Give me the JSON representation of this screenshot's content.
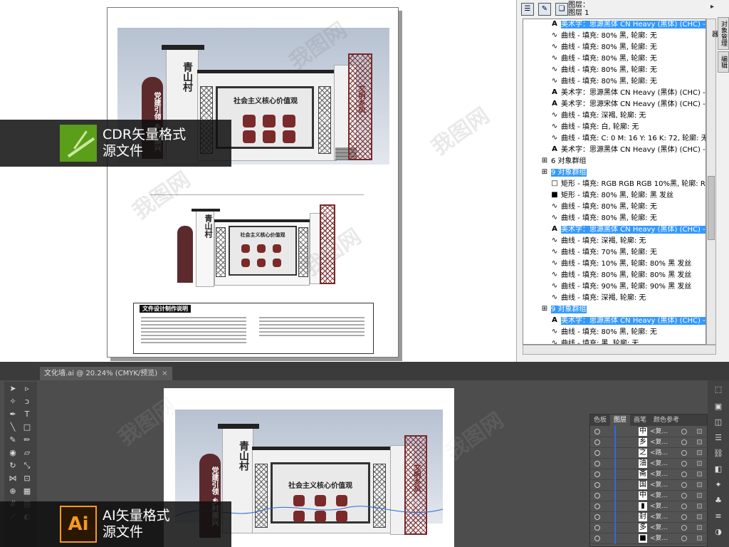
{
  "cdr": {
    "layer_header": [
      "图层：",
      "图层 1"
    ],
    "tree_rows": [
      {
        "icon": "A",
        "text": "美术字：思源黑体 CN Heavy (黑体) (CHC) - ",
        "selected": true,
        "indent": 38
      },
      {
        "icon": "curve",
        "text": "曲线 - 填充: 80% 黑, 轮廓: 无",
        "selected": false,
        "indent": 38
      },
      {
        "icon": "curve",
        "text": "曲线 - 填充: 80% 黑, 轮廓: 无",
        "selected": false,
        "indent": 38
      },
      {
        "icon": "curve",
        "text": "曲线 - 填充: 80% 黑, 轮廓: 无",
        "selected": false,
        "indent": 38
      },
      {
        "icon": "curve",
        "text": "曲线 - 填充: 80% 黑, 轮廓: 无",
        "selected": false,
        "indent": 38
      },
      {
        "icon": "curve",
        "text": "曲线 - 填充: 80% 黑, 轮廓: 无",
        "selected": false,
        "indent": 38
      },
      {
        "icon": "A",
        "text": "美术字：思源黑体 CN Heavy (黑体) (CHC) - 填充: 8",
        "selected": false,
        "indent": 38
      },
      {
        "icon": "A",
        "text": "美术字：思源宋体 CN Heavy (黑体) (CHC) - ",
        "selected": false,
        "indent": 38
      },
      {
        "icon": "curve",
        "text": "曲线 - 填充: 深褐, 轮廓: 无",
        "selected": false,
        "indent": 38
      },
      {
        "icon": "curve",
        "text": "曲线 - 填充: 白, 轮廓: 无",
        "selected": false,
        "indent": 38
      },
      {
        "icon": "curve",
        "text": "曲线 - 填充: C: 0 M: 16 Y: 16 K: 72, 轮廓: 无",
        "selected": false,
        "indent": 38
      },
      {
        "icon": "A",
        "text": "美术字：思源黑体 CN Heavy (黑体) (CHC) - ",
        "selected": false,
        "indent": 38
      },
      {
        "icon": "group",
        "text": "6 对象群组",
        "selected": false,
        "indent": 24
      },
      {
        "icon": "group",
        "text": "9 对象群组",
        "selected": true,
        "indent": 24
      },
      {
        "icon": "rect-empty",
        "text": "矩形 - 填充: RGB RGB RGB 10%黑, 轮廓: RG",
        "selected": false,
        "indent": 38
      },
      {
        "icon": "rect-fill",
        "text": "矩形 - 填充: 80% 黑, 轮廓: 黑 发丝",
        "selected": false,
        "indent": 38
      },
      {
        "icon": "curve",
        "text": "曲线 - 填充: 80% 黑, 轮廓: 无",
        "selected": false,
        "indent": 38
      },
      {
        "icon": "curve",
        "text": "曲线 - 填充: 80% 黑, 轮廓: 无",
        "selected": false,
        "indent": 38
      },
      {
        "icon": "A",
        "text": "美术字：思源黑体 CN Heavy (黑体) (CHC) - ",
        "selected": true,
        "indent": 38
      },
      {
        "icon": "curve",
        "text": "曲线 - 填充: 深褐, 轮廓: 无",
        "selected": false,
        "indent": 38
      },
      {
        "icon": "curve",
        "text": "曲线 - 填充: 70% 黑, 轮廓: 无",
        "selected": false,
        "indent": 38
      },
      {
        "icon": "curve",
        "text": "曲线 - 填充: 10% 黑, 轮廓: 80% 黑 发丝",
        "selected": false,
        "indent": 38
      },
      {
        "icon": "curve",
        "text": "曲线 - 填充: 80% 黑, 轮廓: 80% 黑 发丝",
        "selected": false,
        "indent": 38
      },
      {
        "icon": "curve",
        "text": "曲线 - 填充: 90% 黑, 轮廓: 90% 黑 发丝",
        "selected": false,
        "indent": 38
      },
      {
        "icon": "curve",
        "text": "曲线 - 填充: 深褐, 轮廓: 无",
        "selected": false,
        "indent": 38
      },
      {
        "icon": "group",
        "text": "9 对象群组",
        "selected": true,
        "indent": 24
      },
      {
        "icon": "A",
        "text": "美术字：思源黑体 CN Heavy (黑体) (CHC) - ",
        "selected": true,
        "indent": 38
      },
      {
        "icon": "curve",
        "text": "曲线 - 填充: 80% 黑, 轮廓: 无",
        "selected": false,
        "indent": 38
      },
      {
        "icon": "curve",
        "text": "曲线 - 填充: 黑, 轮廓: 无",
        "selected": false,
        "indent": 38
      }
    ],
    "side_tabs": [
      "对象管理器",
      "编辑"
    ],
    "banner_text": [
      "CDR矢量格式",
      "源文件"
    ]
  },
  "drawing": {
    "village_name": "青山村",
    "party_text": "党建引领 乡村振兴",
    "panel_title": "社会主义核心价值观",
    "right_banner": "文明乡风",
    "notes_title": "文件设计制作说明"
  },
  "ai": {
    "doc_tab": "文化墙.ai @ 20.24% (CMYK/预览)",
    "doc_close": "×",
    "panel_tabs": [
      "色板",
      "图层",
      "画笔",
      "颜色参考"
    ],
    "active_panel_tab": 1,
    "layers": [
      {
        "thumb": "中",
        "name": "<复..."
      },
      {
        "thumb": "乡",
        "name": "<复..."
      },
      {
        "thumb": "之",
        "name": "<路..."
      },
      {
        "thumb": "油",
        "name": "<复..."
      },
      {
        "thumb": "斋",
        "name": "<复..."
      },
      {
        "thumb": "国",
        "name": "<复..."
      },
      {
        "thumb": "中",
        "name": "<复..."
      },
      {
        "thumb": "▮",
        "name": "<复..."
      },
      {
        "thumb": "封",
        "name": "<复..."
      },
      {
        "thumb": "多",
        "name": "<复..."
      },
      {
        "thumb": "■",
        "name": "<复..."
      }
    ],
    "banner_text": [
      "AI矢量格式",
      "源文件"
    ],
    "panel_title": "社会主义核心价值观",
    "village_name": "青山村",
    "party_text": "党建引领 乡村振兴",
    "right_banner": "文明乡风"
  },
  "watermark": "我图网"
}
